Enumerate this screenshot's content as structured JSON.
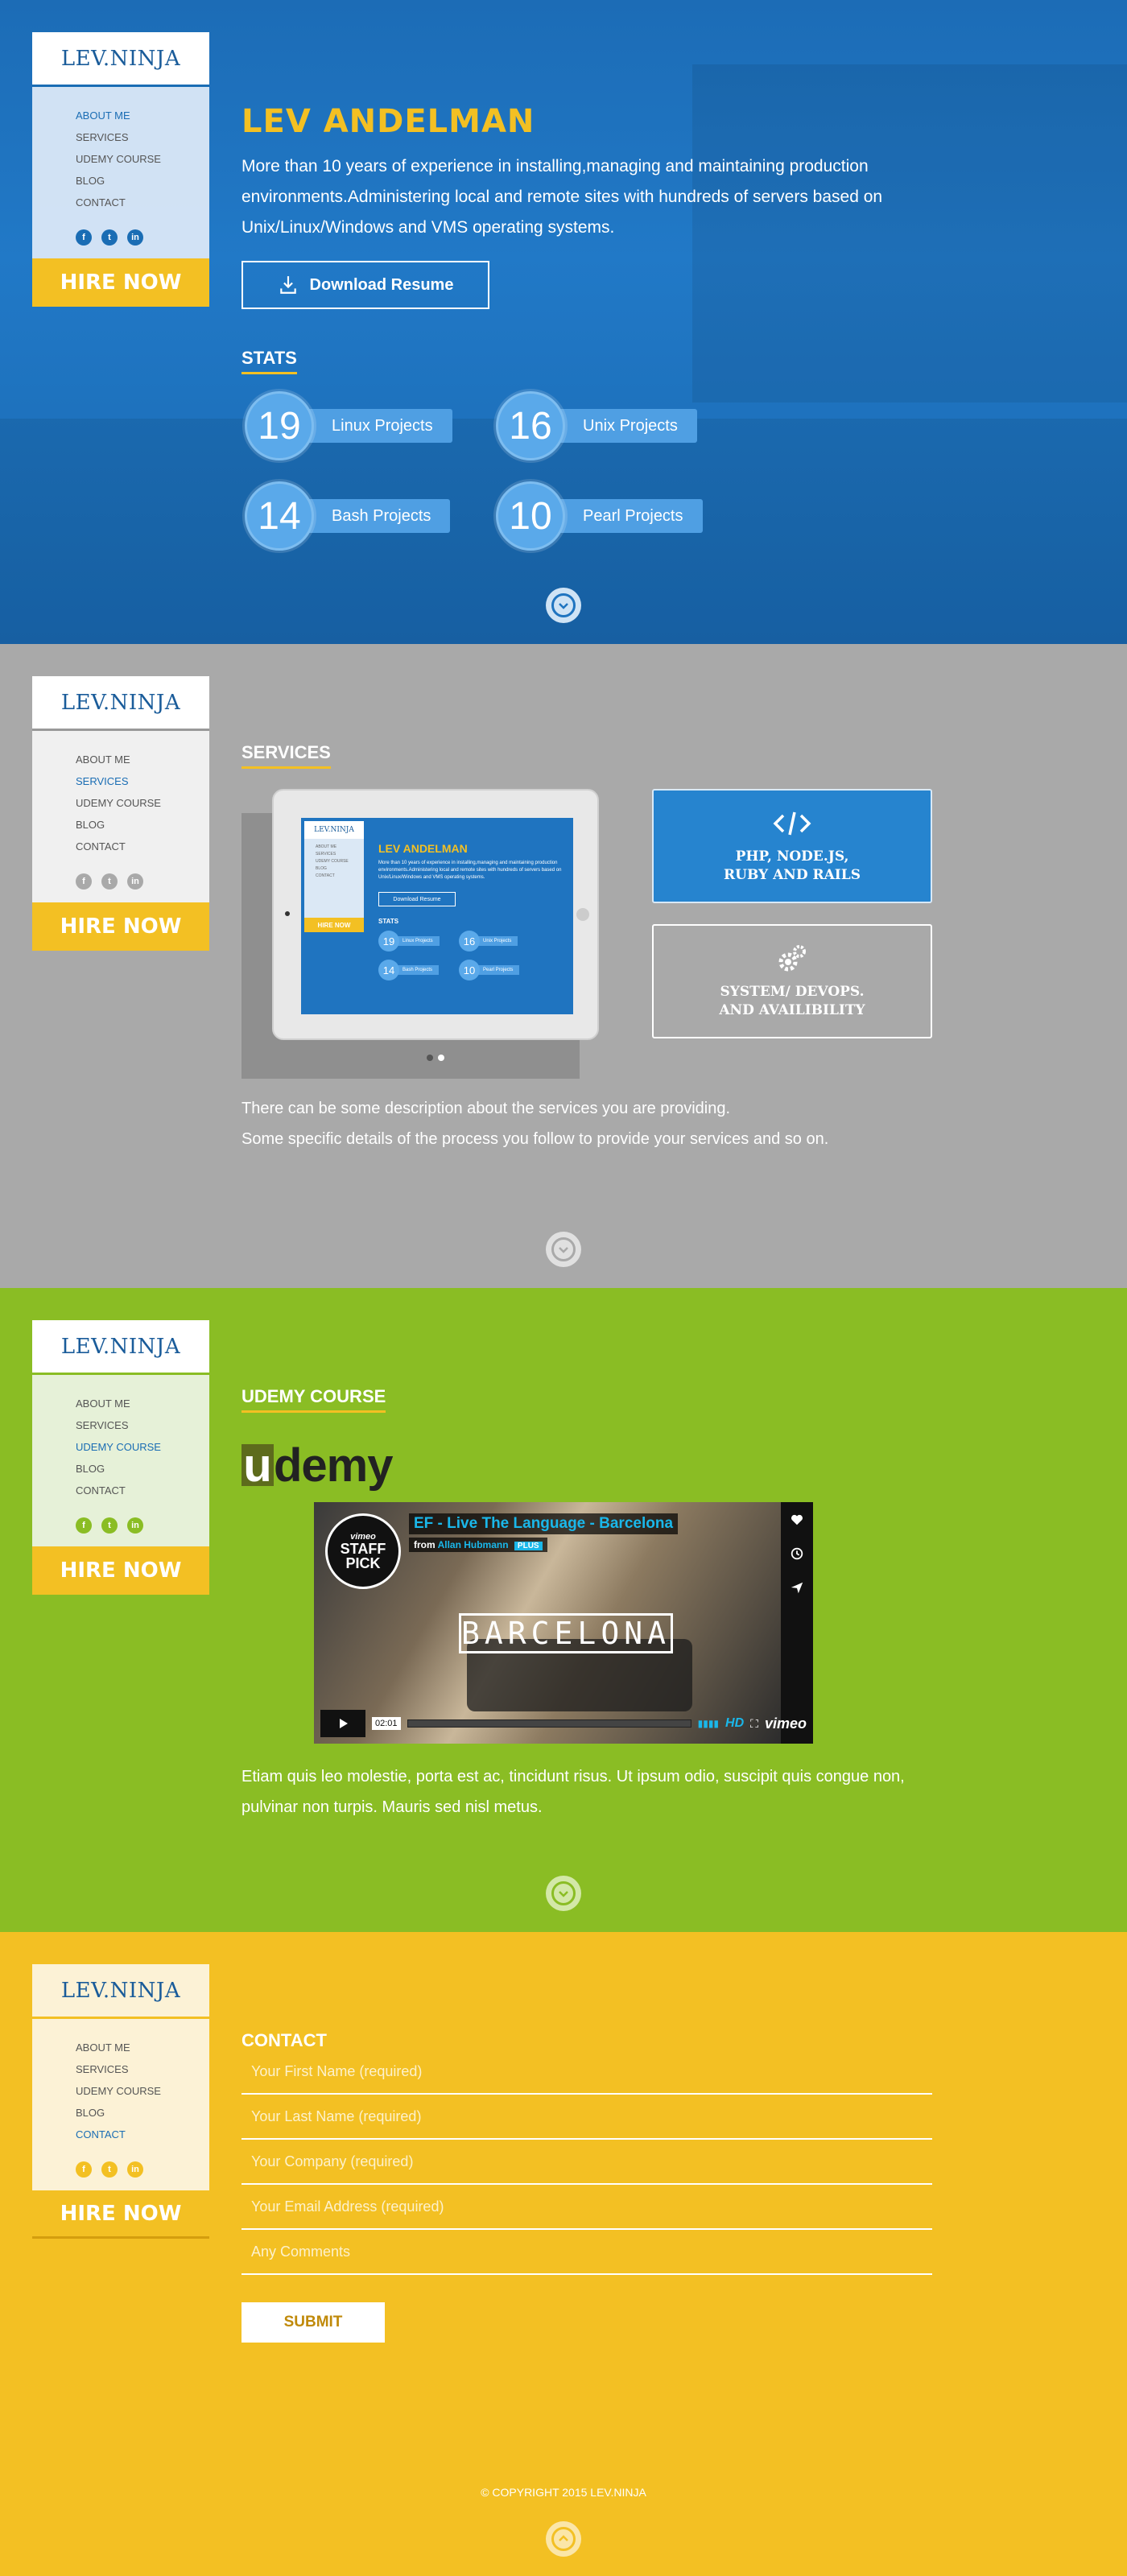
{
  "sidebar": {
    "logo": "LEV.NINJA",
    "nav": [
      "ABOUT ME",
      "SERVICES",
      "UDEMY COURSE",
      "BLOG",
      "CONTACT"
    ],
    "social": [
      "f",
      "t",
      "in"
    ],
    "hire_label": "HIRE NOW"
  },
  "about": {
    "name": "LEV ANDELMAN",
    "intro": "More than 10 years of experience in installing,managing and maintaining production environments.Administering local and remote sites with hundreds of servers based on Unix/Linux/Windows and VMS operating systems.",
    "download_label": "Download Resume",
    "stats_heading": "STATS",
    "stats": [
      {
        "value": "19",
        "label": "Linux Projects"
      },
      {
        "value": "16",
        "label": "Unix Projects"
      },
      {
        "value": "14",
        "label": "Bash Projects"
      },
      {
        "value": "10",
        "label": "Pearl Projects"
      }
    ]
  },
  "services": {
    "heading": "SERVICES",
    "cards": [
      {
        "icon": "code-icon",
        "title_1": "PHP, NODE.JS,",
        "title_2": "RUBY AND RAILS"
      },
      {
        "icon": "gears-icon",
        "title_1": "SYSTEM/ DEVOPS.",
        "title_2": "AND AVAILIBILITY"
      }
    ],
    "desc_1": "There can be some description about the services you are providing.",
    "desc_2": "Some specific details of the process you follow to provide your services and so on."
  },
  "udemy": {
    "heading": "UDEMY COURSE",
    "logo_first": "u",
    "logo_rest": "demy",
    "video": {
      "title": "EF - Live The Language - Barcelona",
      "from": "from",
      "author": "Allan Hubmann",
      "plus": "PLUS",
      "badge_top": "vimeo",
      "badge_main_1": "STAFF",
      "badge_main_2": "PICK",
      "city": "BARCELONA",
      "time": "02:01",
      "hd": "HD",
      "brand": "vimeo"
    },
    "desc": "Etiam quis leo molestie, porta est ac, tincidunt risus. Ut ipsum odio, suscipit quis congue non, pulvinar non turpis. Mauris sed nisl metus."
  },
  "contact": {
    "heading": "CONTACT",
    "fields": [
      "Your First Name (required)",
      "Your Last Name (required)",
      "Your Company (required)",
      "Your Email Address (required)",
      "Any Comments"
    ],
    "submit": "SUBMIT",
    "copyright": "© COPYRIGHT 2015 LEV.NINJA"
  },
  "colors": {
    "blue": "#1f74c0",
    "grey": "#a9a9a9",
    "green": "#8abd24",
    "yellow": "#f3c023"
  }
}
